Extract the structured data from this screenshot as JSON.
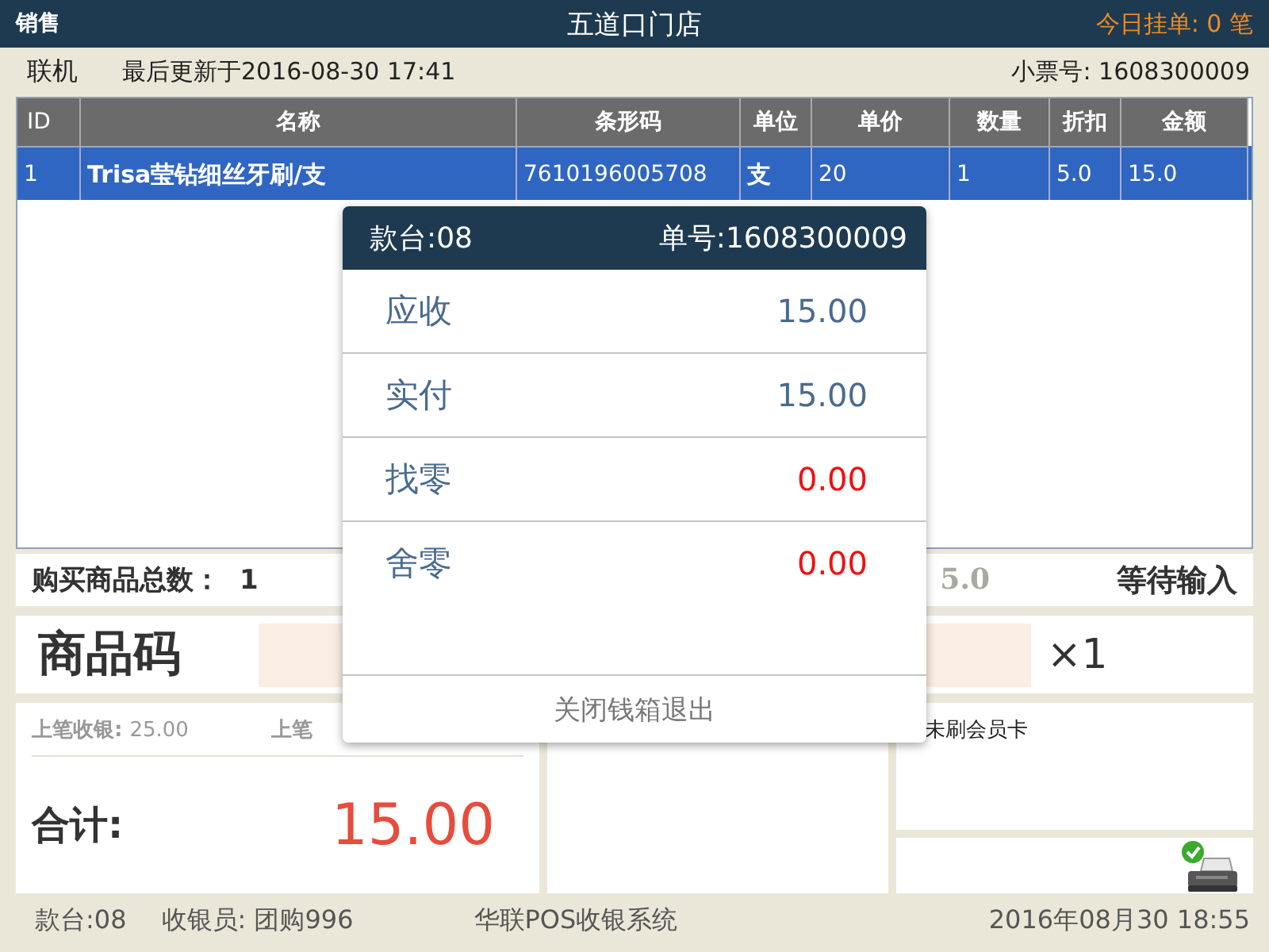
{
  "title_bar": {
    "mode": "销售",
    "store": "五道口门店",
    "pending_label": "今日挂单:",
    "pending_count": "0",
    "pending_unit": "笔"
  },
  "info_bar": {
    "connection": "联机",
    "last_update": "最后更新于2016-08-30 17:41",
    "receipt_label": "小票号:",
    "receipt_no": "1608300009"
  },
  "table": {
    "columns": [
      "ID",
      "名称",
      "条形码",
      "单位",
      "单价",
      "数量",
      "折扣",
      "金额"
    ],
    "rows": [
      {
        "selected": true,
        "cells": [
          "1",
          "Trisa莹钻细丝牙刷/支",
          "7610196005708",
          "支",
          "20",
          "1",
          "5.0",
          "15.0"
        ]
      }
    ]
  },
  "summary": {
    "count_label": "购买商品总数：",
    "count": "1",
    "discount_partial": "5.0",
    "status": "等待输入"
  },
  "barcode": {
    "label": "商品码",
    "quantity": "×1"
  },
  "last_sale": {
    "label": "上笔收银:",
    "value": "25.00",
    "second_label_partial": "上笔"
  },
  "total": {
    "label": "合计:",
    "value": "15.00"
  },
  "member": {
    "text": "未刷会员卡"
  },
  "printer": {
    "ready": true
  },
  "footer": {
    "counter": "款台:08",
    "cashier_label": "收银员:",
    "cashier": "团购996",
    "system": "华联POS收银系统",
    "datetime": "2016年08月30   18:55"
  },
  "dialog": {
    "counter": "款台:08",
    "order": "单号:1608300009",
    "items": [
      {
        "label": "应收",
        "value": "15.00",
        "kind": "due"
      },
      {
        "label": "实付",
        "value": "15.00",
        "kind": "due"
      },
      {
        "label": "找零",
        "value": "0.00",
        "kind": "change"
      },
      {
        "label": "舍零",
        "value": "0.00",
        "kind": "change"
      }
    ],
    "button": "关闭钱箱退出"
  }
}
